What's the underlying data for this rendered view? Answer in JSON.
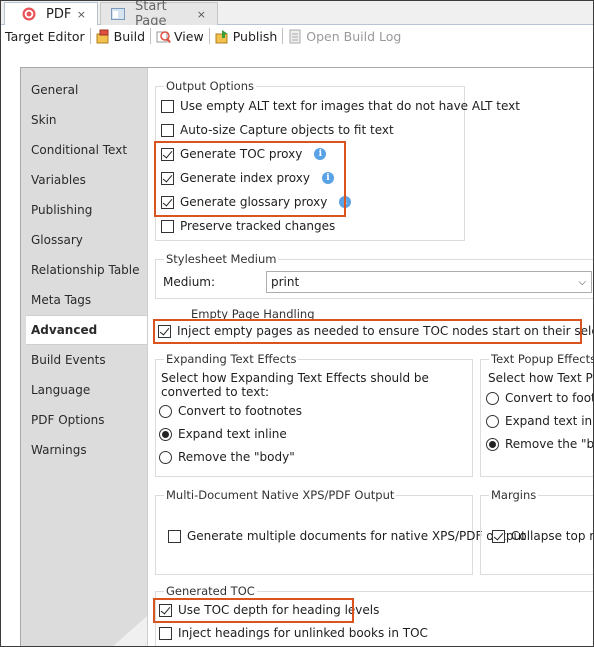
{
  "tabs": [
    {
      "label": "PDF",
      "close": "×",
      "icon": "target-icon",
      "active": true
    },
    {
      "label": "Start Page",
      "close": "×",
      "icon": "start-page-icon",
      "active": false
    }
  ],
  "toolbar": {
    "target_editor": "Target Editor",
    "build": "Build",
    "view": "View",
    "publish": "Publish",
    "open_build_log": "Open Build Log"
  },
  "sidebar": {
    "items": [
      "General",
      "Skin",
      "Conditional Text",
      "Variables",
      "Publishing",
      "Glossary",
      "Relationship Table",
      "Meta Tags",
      "Advanced",
      "Build Events",
      "Language",
      "PDF Options",
      "Warnings"
    ],
    "selected": "Advanced"
  },
  "output_options": {
    "title": "Output Options",
    "options": [
      {
        "label": "Use empty ALT text for images that do not have ALT text",
        "checked": false
      },
      {
        "label": "Auto-size Capture objects to fit text",
        "checked": false
      },
      {
        "label": "Generate TOC proxy",
        "checked": true
      },
      {
        "label": "Generate index proxy",
        "checked": true
      },
      {
        "label": "Generate glossary proxy",
        "checked": true
      },
      {
        "label": "Preserve tracked changes",
        "checked": false
      }
    ],
    "info_glyph": "i"
  },
  "stylesheet_medium": {
    "title": "Stylesheet Medium",
    "label": "Medium:",
    "value": "print"
  },
  "empty_page_handling": {
    "title": "Empty Page Handling",
    "option": {
      "label": "Inject empty pages as needed to ensure TOC nodes start on their selected pages",
      "checked": true
    }
  },
  "expanding_text_effects": {
    "title": "Expanding Text Effects",
    "description": "Select how Expanding Text Effects should be converted to text:",
    "options": [
      "Convert to footnotes",
      "Expand text inline",
      "Remove the \"body\""
    ],
    "selected": 1
  },
  "text_popup_effects": {
    "title": "Text Popup Effects",
    "description": "Select how Text Popup",
    "options": [
      "Convert to footnot",
      "Expand text inline",
      "Remove the \"body"
    ],
    "selected": 2
  },
  "multi_document": {
    "title": "Multi-Document Native XPS/PDF Output",
    "option": {
      "label": "Generate multiple documents for native XPS/PDF output",
      "checked": false
    }
  },
  "margins": {
    "title": "Margins",
    "option": {
      "label": "Collapse top marg",
      "checked": true
    }
  },
  "generated_toc": {
    "title": "Generated TOC",
    "options": [
      {
        "label": "Use TOC depth for heading levels",
        "checked": true
      },
      {
        "label": "Inject headings for unlinked books in TOC",
        "checked": false
      }
    ]
  },
  "colors": {
    "highlight_box": "#d9541e",
    "sidebar_bg": "#dcdcdc",
    "info_icon": "#5aa2e6"
  }
}
